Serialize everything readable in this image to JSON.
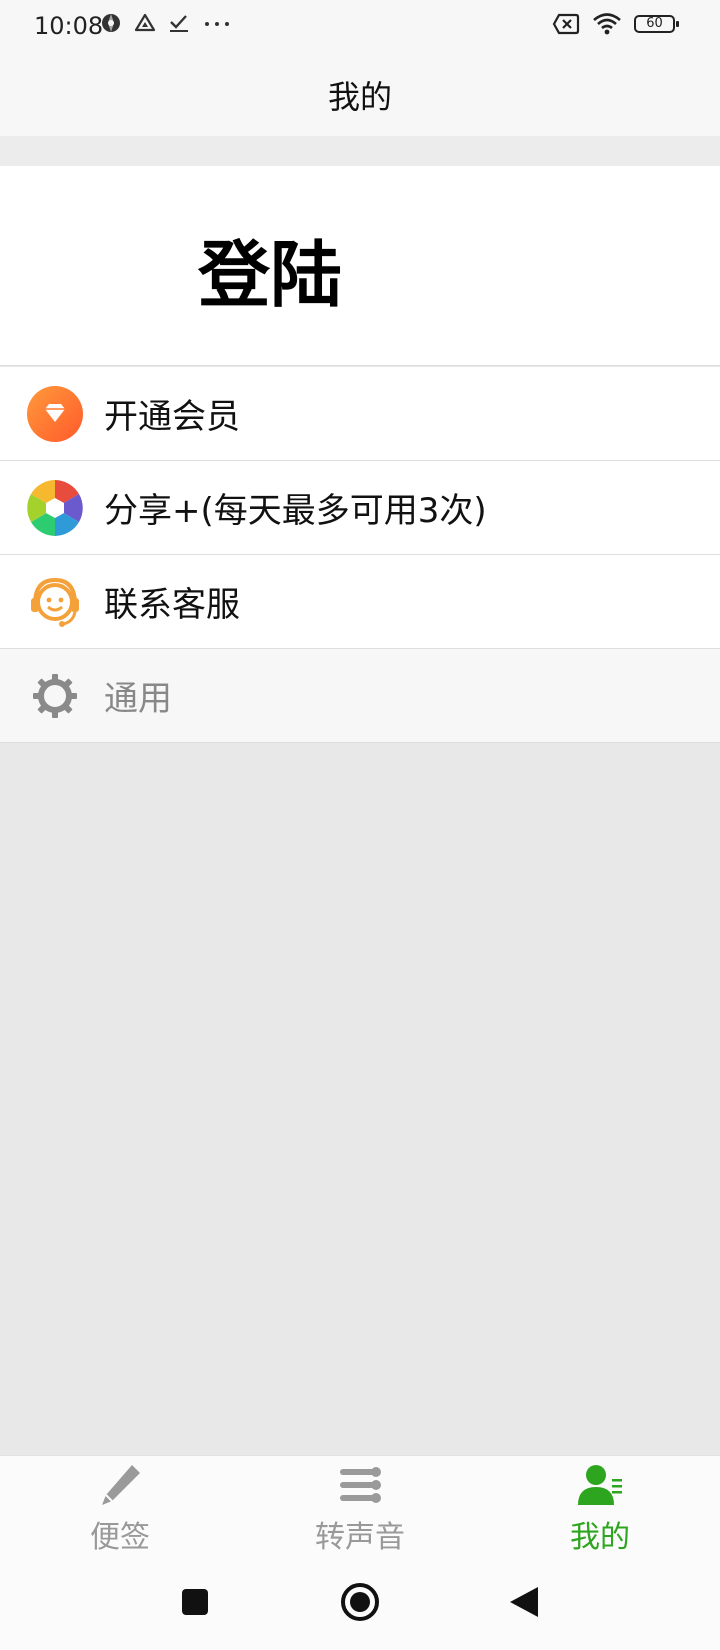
{
  "status_bar": {
    "time": "10:08",
    "battery": "60",
    "left_icons": [
      "app-icon",
      "drive-icon",
      "checkmark-icon",
      "more-dots-icon"
    ],
    "right_icons": [
      "sim-off-icon",
      "wifi-icon",
      "battery-icon"
    ]
  },
  "header": {
    "title": "我的"
  },
  "login": {
    "label": "登陆"
  },
  "menu": [
    {
      "label": "开通会员",
      "icon": "diamond-icon"
    },
    {
      "label": "分享+(每天最多可用3次)",
      "icon": "aperture-share-icon"
    },
    {
      "label": "联系客服",
      "icon": "customer-service-icon"
    },
    {
      "label": "通用",
      "icon": "gear-icon"
    }
  ],
  "tabs": [
    {
      "label": "便签",
      "icon": "pencil-icon",
      "active": false
    },
    {
      "label": "转声音",
      "icon": "equalizer-icon",
      "active": false
    },
    {
      "label": "我的",
      "icon": "user-icon",
      "active": true
    }
  ],
  "nav": [
    "recents-square-icon",
    "home-circle-icon",
    "back-triangle-icon"
  ],
  "colors": {
    "accent_green": "#2ea51f",
    "orange": "#ff7a2e",
    "background": "#e8e8e8"
  }
}
